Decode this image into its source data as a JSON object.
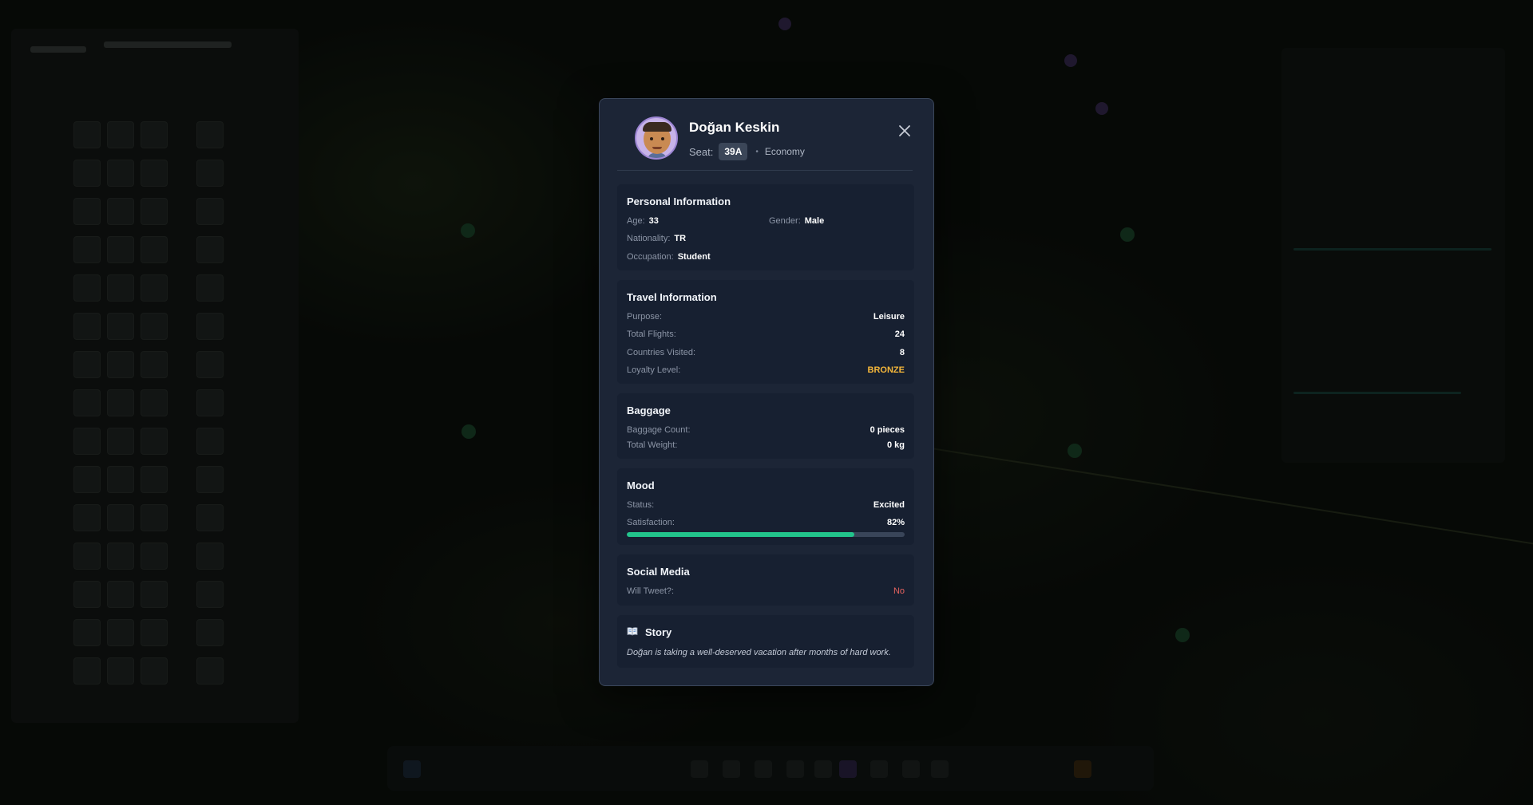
{
  "passenger": {
    "name": "Doğan Keskin",
    "seat_label": "Seat:",
    "seat": "39A",
    "cabin_class": "Economy",
    "avatar_icon": "passenger-avatar",
    "close_icon": "close-icon"
  },
  "personal": {
    "title": "Personal Information",
    "age_label": "Age:",
    "age": "33",
    "gender_label": "Gender:",
    "gender": "Male",
    "nationality_label": "Nationality:",
    "nationality": "TR",
    "occupation_label": "Occupation:",
    "occupation": "Student"
  },
  "travel": {
    "title": "Travel Information",
    "purpose_label": "Purpose:",
    "purpose": "Leisure",
    "flights_label": "Total Flights:",
    "flights": "24",
    "countries_label": "Countries Visited:",
    "countries": "8",
    "loyalty_label": "Loyalty Level:",
    "loyalty": "BRONZE",
    "loyalty_color": "#f4b63a"
  },
  "baggage": {
    "title": "Baggage",
    "count_label": "Baggage Count:",
    "count": "0 pieces",
    "weight_label": "Total Weight:",
    "weight": "0 kg"
  },
  "mood": {
    "title": "Mood",
    "status_label": "Status:",
    "status": "Excited",
    "satisfaction_label": "Satisfaction:",
    "satisfaction": "82%",
    "satisfaction_fraction": 0.82,
    "bar_color": "#22c48c"
  },
  "social": {
    "title": "Social Media",
    "tweet_label": "Will Tweet?:",
    "tweet": "No",
    "tweet_color": "#e5625e"
  },
  "story": {
    "icon": "book-icon",
    "title": "Story",
    "text": "Doğan is taking a well-deserved vacation after months of hard work."
  }
}
